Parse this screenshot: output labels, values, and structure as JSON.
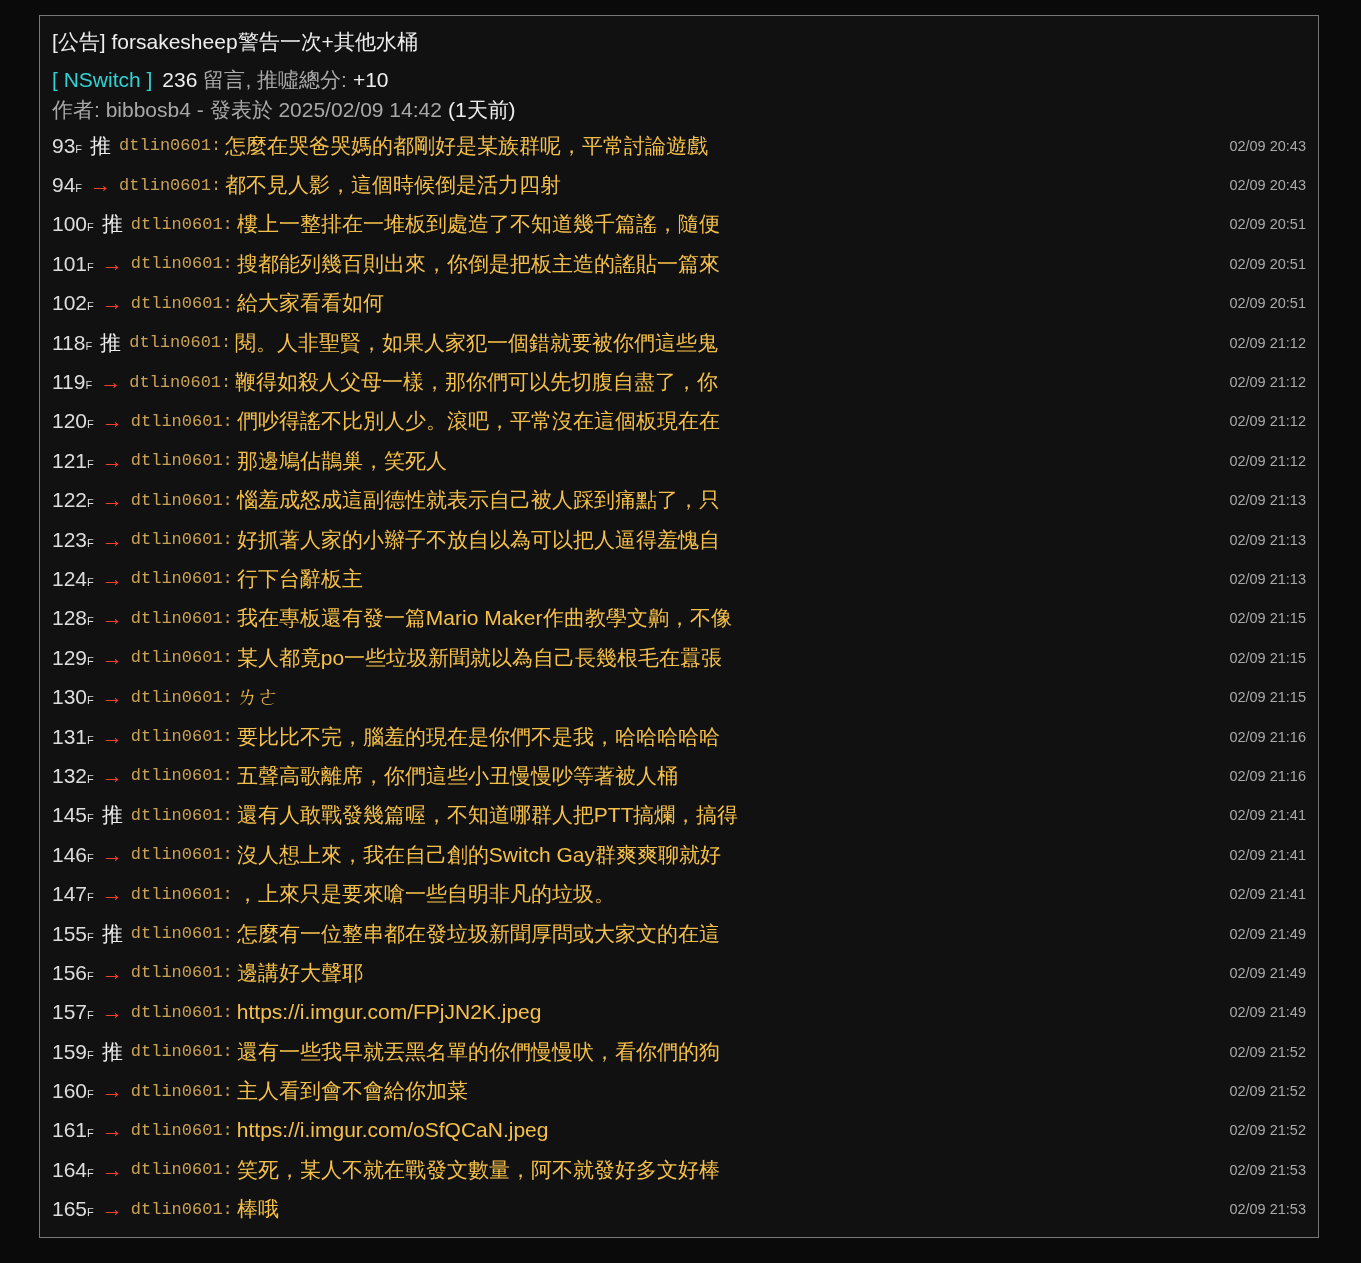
{
  "post": {
    "title": "[公告] forsakesheep警告一次+其他水桶",
    "board": "[ NSwitch ]",
    "comment_count": "236",
    "count_label": "留言, 推噓總分:",
    "score": "+10",
    "byline": "作者: bibbosb4 - 發表於 2025/02/09 14:42",
    "age": "(1天前)"
  },
  "comments": [
    {
      "floor": "93$_{F}$",
      "kind": "push",
      "tag": "推",
      "user": "dtlin0601:",
      "text": "怎麼在哭爸哭媽的都剛好是某族群呢，平常討論遊戲",
      "time": "02/09 20:43"
    },
    {
      "floor": "94$_{F}$",
      "kind": "arrow",
      "tag": "→",
      "user": "dtlin0601:",
      "text": "都不見人影，這個時候倒是活力四射",
      "time": "02/09 20:43"
    },
    {
      "floor": "100$_{F}$",
      "kind": "push",
      "tag": "推",
      "user": "dtlin0601:",
      "text": "樓上一整排在一堆板到處造了不知道幾千篇謠，隨便",
      "time": "02/09 20:51"
    },
    {
      "floor": "101$_{F}$",
      "kind": "arrow",
      "tag": "→",
      "user": "dtlin0601:",
      "text": "搜都能列幾百則出來，你倒是把板主造的謠貼一篇來",
      "time": "02/09 20:51"
    },
    {
      "floor": "102$_{F}$",
      "kind": "arrow",
      "tag": "→",
      "user": "dtlin0601:",
      "text": "給大家看看如何",
      "time": "02/09 20:51"
    },
    {
      "floor": "118$_{F}$",
      "kind": "push",
      "tag": "推",
      "user": "dtlin0601:",
      "text": "閱。人非聖賢，如果人家犯一個錯就要被你們這些鬼",
      "time": "02/09 21:12"
    },
    {
      "floor": "119$_{F}$",
      "kind": "arrow",
      "tag": "→",
      "user": "dtlin0601:",
      "text": "鞭得如殺人父母一樣，那你們可以先切腹自盡了，你",
      "time": "02/09 21:12"
    },
    {
      "floor": "120$_{F}$",
      "kind": "arrow",
      "tag": "→",
      "user": "dtlin0601:",
      "text": "們吵得謠不比別人少。滾吧，平常沒在這個板現在在",
      "time": "02/09 21:12"
    },
    {
      "floor": "121$_{F}$",
      "kind": "arrow",
      "tag": "→",
      "user": "dtlin0601:",
      "text": "那邊鳩佔鵲巢，笑死人",
      "time": "02/09 21:12"
    },
    {
      "floor": "122$_{F}$",
      "kind": "arrow",
      "tag": "→",
      "user": "dtlin0601:",
      "text": "惱羞成怒成這副德性就表示自己被人踩到痛點了，只",
      "time": "02/09 21:13"
    },
    {
      "floor": "123$_{F}$",
      "kind": "arrow",
      "tag": "→",
      "user": "dtlin0601:",
      "text": "好抓著人家的小辮子不放自以為可以把人逼得羞愧自",
      "time": "02/09 21:13"
    },
    {
      "floor": "124$_{F}$",
      "kind": "arrow",
      "tag": "→",
      "user": "dtlin0601:",
      "text": "行下台辭板主",
      "time": "02/09 21:13"
    },
    {
      "floor": "128$_{F}$",
      "kind": "arrow",
      "tag": "→",
      "user": "dtlin0601:",
      "text": "我在專板還有發一篇Mario Maker作曲教學文齁，不像",
      "time": "02/09 21:15"
    },
    {
      "floor": "129$_{F}$",
      "kind": "arrow",
      "tag": "→",
      "user": "dtlin0601:",
      "text": "某人都竟po一些垃圾新聞就以為自己長幾根毛在囂張",
      "time": "02/09 21:15"
    },
    {
      "floor": "130$_{F}$",
      "kind": "arrow",
      "tag": "→",
      "user": "dtlin0601:",
      "text": "ㄌㄜ",
      "time": "02/09 21:15"
    },
    {
      "floor": "131$_{F}$",
      "kind": "arrow",
      "tag": "→",
      "user": "dtlin0601:",
      "text": "要比比不完，腦羞的現在是你們不是我，哈哈哈哈哈",
      "time": "02/09 21:16"
    },
    {
      "floor": "132$_{F}$",
      "kind": "arrow",
      "tag": "→",
      "user": "dtlin0601:",
      "text": "五聲高歌離席，你們這些小丑慢慢吵等著被人桶",
      "time": "02/09 21:16"
    },
    {
      "floor": "145$_{F}$",
      "kind": "push",
      "tag": "推",
      "user": "dtlin0601:",
      "text": "還有人敢戰發幾篇喔，不知道哪群人把PTT搞爛，搞得",
      "time": "02/09 21:41"
    },
    {
      "floor": "146$_{F}$",
      "kind": "arrow",
      "tag": "→",
      "user": "dtlin0601:",
      "text": "沒人想上來，我在自己創的Switch Gay群爽爽聊就好",
      "time": "02/09 21:41"
    },
    {
      "floor": "147$_{F}$",
      "kind": "arrow",
      "tag": "→",
      "user": "dtlin0601:",
      "text": "，上來只是要來嗆一些自明非凡的垃圾。",
      "time": "02/09 21:41"
    },
    {
      "floor": "155$_{F}$",
      "kind": "push",
      "tag": "推",
      "user": "dtlin0601:",
      "text": "怎麼有一位整串都在發垃圾新聞厚問或大家文的在這",
      "time": "02/09 21:49"
    },
    {
      "floor": "156$_{F}$",
      "kind": "arrow",
      "tag": "→",
      "user": "dtlin0601:",
      "text": "邊講好大聲耶",
      "time": "02/09 21:49"
    },
    {
      "floor": "157$_{F}$",
      "kind": "arrow",
      "tag": "→",
      "user": "dtlin0601:",
      "text": "https://i.imgur.com/FPjJN2K.jpeg",
      "time": "02/09 21:49"
    },
    {
      "floor": "159$_{F}$",
      "kind": "push",
      "tag": "推",
      "user": "dtlin0601:",
      "text": "還有一些我早就丟黑名單的你們慢慢吠，看你們的狗",
      "time": "02/09 21:52"
    },
    {
      "floor": "160$_{F}$",
      "kind": "arrow",
      "tag": "→",
      "user": "dtlin0601:",
      "text": "主人看到會不會給你加菜",
      "time": "02/09 21:52"
    },
    {
      "floor": "161$_{F}$",
      "kind": "arrow",
      "tag": "→",
      "user": "dtlin0601:",
      "text": "https://i.imgur.com/oSfQCaN.jpeg",
      "time": "02/09 21:52"
    },
    {
      "floor": "164$_{F}$",
      "kind": "arrow",
      "tag": "→",
      "user": "dtlin0601:",
      "text": "笑死，某人不就在戰發文數量，阿不就發好多文好棒",
      "time": "02/09 21:53"
    },
    {
      "floor": "165$_{F}$",
      "kind": "arrow",
      "tag": "→",
      "user": "dtlin0601:",
      "text": "棒哦",
      "time": "02/09 21:53"
    }
  ]
}
